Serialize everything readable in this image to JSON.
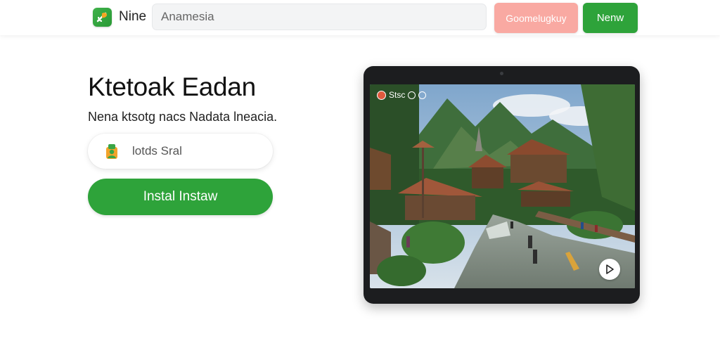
{
  "header": {
    "brand": "Nine",
    "search_placeholder": "Anamesia",
    "pink_button_label": "Goomelugkuy",
    "green_button_label": "Nenw"
  },
  "hero": {
    "title": "Ktetoak Eadan",
    "subtitle": "Nena ktsotg nacs Nadata lneacia.",
    "pill_label": "lotds Sral",
    "install_label": "Instal Instaw"
  },
  "tablet": {
    "overlay_text": "Stsc"
  },
  "colors": {
    "accent_green": "#2ea33a",
    "pink": "#f9a9a2"
  },
  "icons": {
    "logo": "app-logo-icon",
    "pill": "user-badge-icon",
    "play": "play-icon"
  }
}
